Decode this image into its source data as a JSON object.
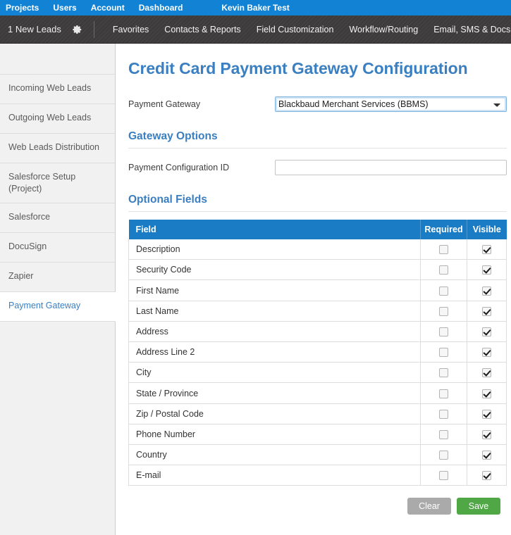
{
  "topbar": {
    "links": [
      {
        "label": "Projects",
        "name": "projects"
      },
      {
        "label": "Users",
        "name": "users"
      },
      {
        "label": "Account",
        "name": "account"
      },
      {
        "label": "Dashboard",
        "name": "dashboard"
      }
    ],
    "user_name": "Kevin Baker Test",
    "bg_color": "#1283d4"
  },
  "subbar": {
    "leads_label": "1 New Leads",
    "gear_icon": "gear-icon",
    "menu": [
      {
        "label": "Favorites",
        "name": "favorites"
      },
      {
        "label": "Contacts & Reports",
        "name": "contacts-reports"
      },
      {
        "label": "Field Customization",
        "name": "field-customization"
      },
      {
        "label": "Workflow/Routing",
        "name": "workflow-routing"
      },
      {
        "label": "Email, SMS & Docs",
        "name": "email-sms-docs"
      }
    ],
    "bg_color": "#403e3e"
  },
  "sidebar": {
    "items": [
      {
        "label": "",
        "name": "spacer",
        "active": false,
        "spacer": true
      },
      {
        "label": "Incoming Web Leads",
        "name": "incoming-web-leads",
        "active": false
      },
      {
        "label": "Outgoing Web Leads",
        "name": "outgoing-web-leads",
        "active": false
      },
      {
        "label": "Web Leads Distribution",
        "name": "web-leads-distribution",
        "active": false
      },
      {
        "label": "Salesforce Setup (Project)",
        "name": "salesforce-setup-project",
        "active": false
      },
      {
        "label": "Salesforce",
        "name": "salesforce",
        "active": false
      },
      {
        "label": "DocuSign",
        "name": "docusign",
        "active": false
      },
      {
        "label": "Zapier",
        "name": "zapier",
        "active": false
      },
      {
        "label": "Payment Gateway",
        "name": "payment-gateway",
        "active": true
      }
    ],
    "active_color": "#3a7fc1"
  },
  "main": {
    "page_title": "Credit Card Payment Gateway Configuration",
    "title_color": "#3a7fc1",
    "payment_gateway_label": "Payment Gateway",
    "payment_gateway_value": "Blackbaud Merchant Services (BBMS)",
    "payment_gateway_options": [
      "Blackbaud Merchant Services (BBMS)"
    ],
    "gateway_options_heading": "Gateway Options",
    "payment_config_id_label": "Payment Configuration ID",
    "payment_config_id_value": "",
    "payment_config_id_placeholder": "",
    "optional_fields_heading": "Optional Fields",
    "table": {
      "columns": [
        "Field",
        "Required",
        "Visible"
      ],
      "header_bg": "#1a7cc4",
      "rows": [
        {
          "field": "Description",
          "required": false,
          "visible": true
        },
        {
          "field": "Security Code",
          "required": false,
          "visible": true
        },
        {
          "field": "First Name",
          "required": false,
          "visible": true
        },
        {
          "field": "Last Name",
          "required": false,
          "visible": true
        },
        {
          "field": "Address",
          "required": false,
          "visible": true
        },
        {
          "field": "Address Line 2",
          "required": false,
          "visible": true
        },
        {
          "field": "City",
          "required": false,
          "visible": true
        },
        {
          "field": "State / Province",
          "required": false,
          "visible": true
        },
        {
          "field": "Zip / Postal Code",
          "required": false,
          "visible": true
        },
        {
          "field": "Phone Number",
          "required": false,
          "visible": true
        },
        {
          "field": "Country",
          "required": false,
          "visible": true
        },
        {
          "field": "E-mail",
          "required": false,
          "visible": true
        }
      ]
    },
    "buttons": {
      "clear_label": "Clear",
      "clear_color": "#aaaaaa",
      "save_label": "Save",
      "save_color": "#4fa845"
    }
  }
}
